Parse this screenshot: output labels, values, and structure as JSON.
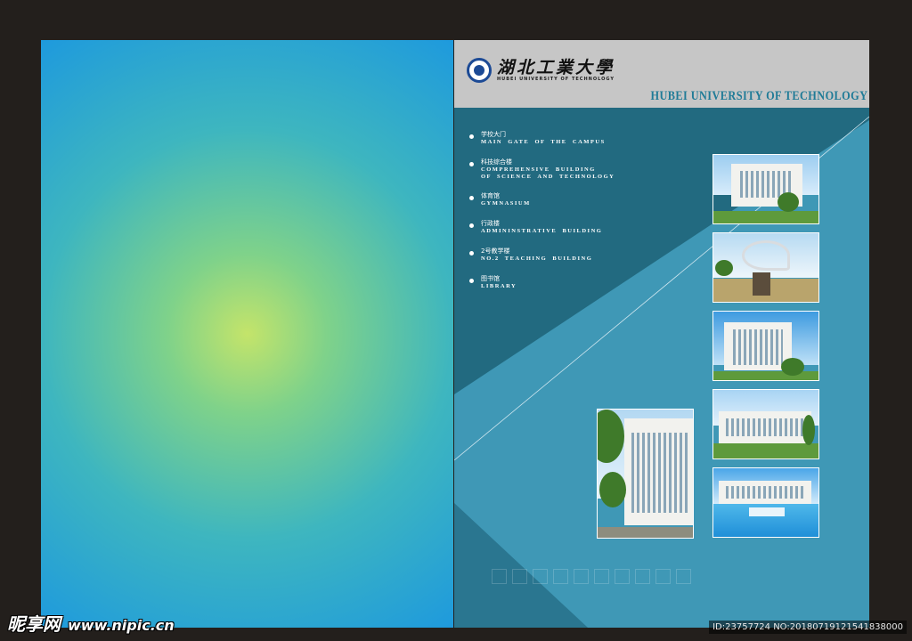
{
  "header": {
    "logo_cn": "湖北工業大學",
    "logo_en": "HUBEI UNIVERSITY OF TECHNOLOGY",
    "title": "HUBEI UNIVERSITY OF TECHNOLOGY"
  },
  "menu": {
    "items": [
      {
        "cn": "学校大门",
        "en": "MAIN  GATE  OF  THE  CAMPUS"
      },
      {
        "cn": "科技综合楼",
        "en": "COMPREHENSIVE  BUILDING\nOF  SCIENCE  AND  TECHNOLOGY"
      },
      {
        "cn": "体育馆",
        "en": "GYMNASIUM"
      },
      {
        "cn": "行政楼",
        "en": "ADMININSTRATIVE  BUILDING"
      },
      {
        "cn": "2号教学楼",
        "en": "NO.2  TEACHING  BUILDING"
      },
      {
        "cn": "图书馆",
        "en": "LIBRARY"
      }
    ]
  },
  "watermark": {
    "site_cn": "昵享网",
    "site_url": "www.nipic.cn",
    "id_text": "ID:23757724 NO:20180719121541838000"
  },
  "colors": {
    "background": "#231f1c",
    "right_panel": "#226a80",
    "accent_triangle": "#3f98b6",
    "header_band": "#c6c6c6",
    "title_blue": "#1f7b97"
  },
  "icons": {
    "logo": "university-seal-icon",
    "bullet": "bullet-dot-icon"
  }
}
